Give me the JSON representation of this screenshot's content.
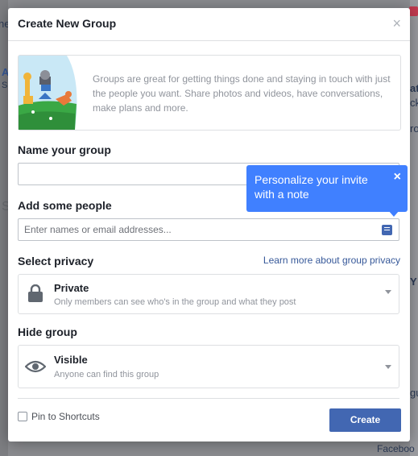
{
  "background": {
    "fragments": [
      {
        "text": "he",
        "name": "bg-text-left-1"
      },
      {
        "text": "A",
        "name": "bg-text-left-2"
      },
      {
        "text": "S",
        "name": "bg-text-left-3"
      },
      {
        "text": "S",
        "name": "bg-text-left-4"
      },
      {
        "text": "at",
        "name": "bg-text-right-1"
      },
      {
        "text": "ck",
        "name": "bg-text-right-2"
      },
      {
        "text": "ro",
        "name": "bg-text-right-3"
      },
      {
        "text": "Y",
        "name": "bg-text-right-4"
      },
      {
        "text": "gu",
        "name": "bg-text-right-5"
      },
      {
        "text": "Faceboo",
        "name": "bg-text-right-6"
      }
    ]
  },
  "modal": {
    "title": "Create New Group",
    "close_glyph": "×",
    "intro_text": "Groups are great for getting things done and staying in touch with just the people you want. Share photos and videos, have conversations, make plans and more."
  },
  "name_section": {
    "label": "Name your group",
    "value": "",
    "placeholder": ""
  },
  "people_section": {
    "label": "Add some people",
    "placeholder": "Enter names or email addresses...",
    "note_icon": "note-icon"
  },
  "tooltip": {
    "text": "Personalize your invite with a note",
    "close_glyph": "×"
  },
  "privacy_section": {
    "label": "Select privacy",
    "learn_link": "Learn more about group privacy",
    "selected_title": "Private",
    "selected_desc": "Only members can see who's in the group and what they post",
    "icon": "lock-icon"
  },
  "hide_section": {
    "label": "Hide group",
    "selected_title": "Visible",
    "selected_desc": "Anyone can find this group",
    "icon": "eye-icon"
  },
  "footer": {
    "pin_label": "Pin to Shortcuts",
    "pin_checked": false,
    "create_label": "Create"
  },
  "colors": {
    "accent": "#4267b2",
    "tooltip": "#4080ff",
    "link": "#365899"
  }
}
